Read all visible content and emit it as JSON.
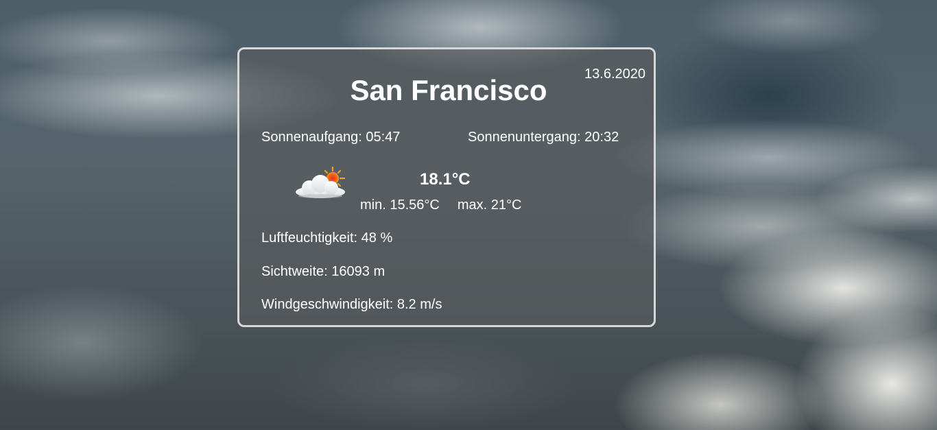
{
  "weather": {
    "date": "13.6.2020",
    "city": "San Francisco",
    "sunrise": "Sonnenaufgang: 05:47",
    "sunset": "Sonnenuntergang: 20:32",
    "icon": "partly-cloudy-icon",
    "temperature": "18.1°C",
    "min": "min. 15.56°C",
    "max": "max. 21°C",
    "humidity": "Luftfeuchtigkeit: 48 %",
    "visibility": "Sichtweite: 16093 m",
    "wind": "Windgeschwindigkeit: 8.2 m/s"
  },
  "colors": {
    "card_border": "#d7d7d7",
    "text": "#ffffff",
    "sun": "#f4a020"
  }
}
